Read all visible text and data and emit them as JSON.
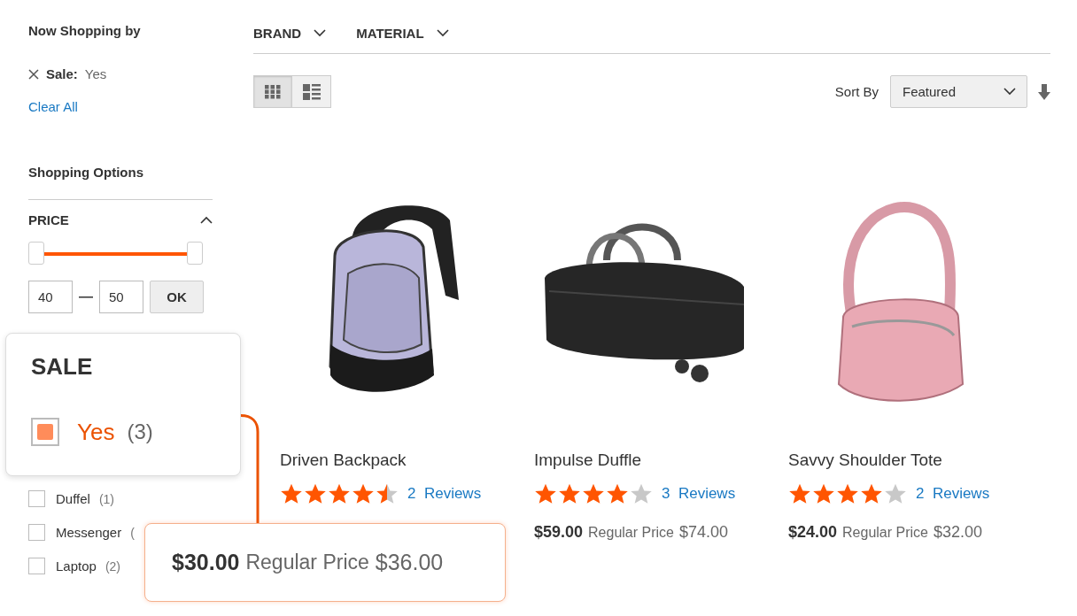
{
  "now_shopping": {
    "title": "Now Shopping by",
    "items": [
      {
        "label": "Sale:",
        "value": "Yes"
      }
    ],
    "clear_link": "Clear All"
  },
  "shopping_options": {
    "title": "Shopping Options",
    "price_filter": {
      "title": "PRICE",
      "expanded": true,
      "from": "40",
      "to": "50",
      "apply_button": "OK"
    },
    "category_options": [
      {
        "label": "Duffel",
        "count": "(1)",
        "checked": false
      },
      {
        "label": "Messenger",
        "count": "(",
        "checked": false
      },
      {
        "label": "Laptop",
        "count": "(2)",
        "checked": false
      }
    ]
  },
  "toolbar": {
    "filters": [
      {
        "label": "BRAND"
      },
      {
        "label": "MATERIAL"
      }
    ],
    "view_modes": [
      {
        "kind": "grid",
        "selected": true
      },
      {
        "kind": "list",
        "selected": false
      }
    ],
    "sort_label": "Sort By",
    "sort_value": "Featured"
  },
  "products": [
    {
      "name": "Driven Backpack",
      "stars": 4.5,
      "reviews_count": "2",
      "reviews_label": "Reviews"
    },
    {
      "name": "Impulse Duffle",
      "stars": 4,
      "reviews_count": "3",
      "reviews_label": "Reviews",
      "price": "$59.00",
      "regular_label": "Regular Price",
      "regular_price": "$74.00"
    },
    {
      "name": "Savvy Shoulder Tote",
      "stars": 4,
      "reviews_count": "2",
      "reviews_label": "Reviews",
      "price": "$24.00",
      "regular_label": "Regular Price",
      "regular_price": "$32.00"
    }
  ],
  "sale_callout": {
    "title": "SALE",
    "option": {
      "label": "Yes",
      "count": "(3)",
      "checked": true
    }
  },
  "price_callout": {
    "price": "$30.00",
    "regular_label": "Regular Price",
    "regular_price": "$36.00"
  }
}
